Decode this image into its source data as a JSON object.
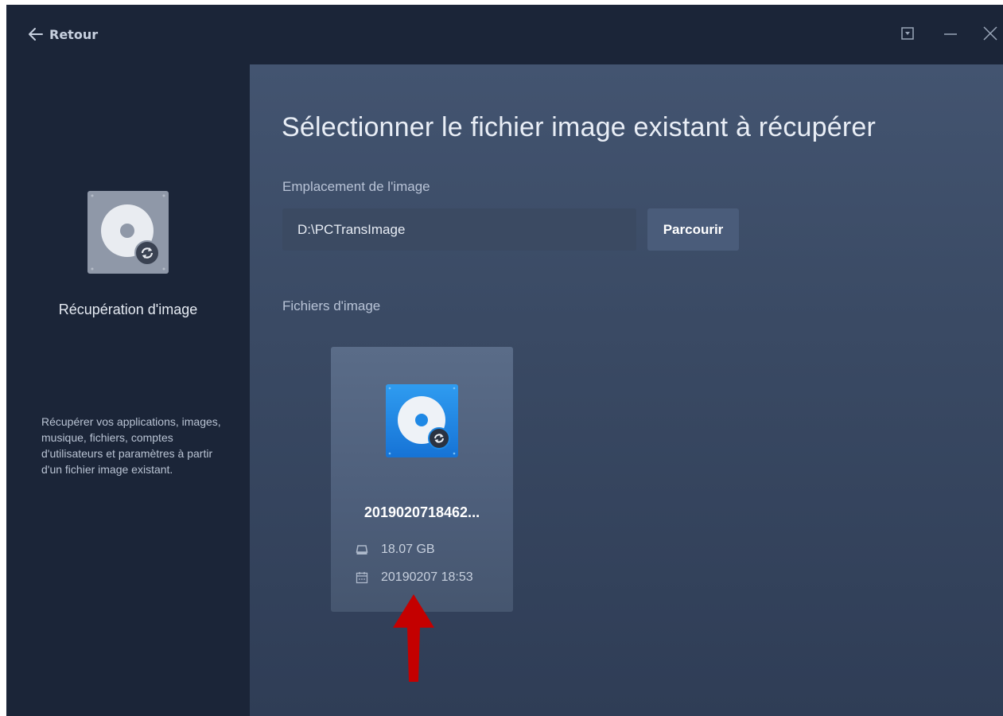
{
  "titlebar": {
    "back_label": "Retour",
    "controls": [
      "dropdown-menu-icon",
      "minimize-icon",
      "close-icon"
    ]
  },
  "sidebar": {
    "icon": "disk-image-recovery-icon",
    "title": "Récupération d'image",
    "description": "Récupérer vos applications, images, musique, fichiers, comptes d'utilisateurs et paramètres à partir d'un fichier image existant."
  },
  "main": {
    "title": "Sélectionner le fichier image existant à récupérer",
    "location_label": "Emplacement de l'image",
    "location_value": "D:\\PCTransImage",
    "browse_label": "Parcourir",
    "files_label": "Fichiers d'image",
    "files": [
      {
        "name": "2019020718462...",
        "size": "18.07 GB",
        "date": "20190207 18:53",
        "icon": "disk-image-recovery-icon"
      }
    ]
  },
  "colors": {
    "background_dark": "#1b2538",
    "main_panel": "#3a4a64",
    "card": "#52637f",
    "button": "#4a5c7a",
    "accent_blue": "#1e88e5",
    "annotation_red": "#c40000"
  }
}
